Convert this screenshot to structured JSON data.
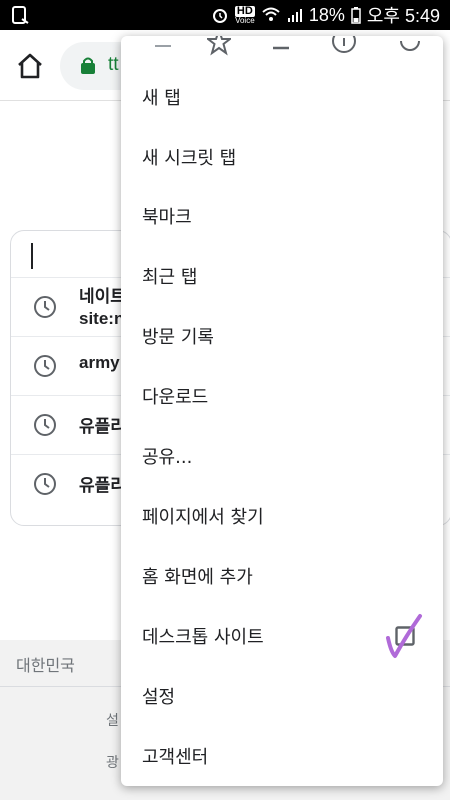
{
  "status_bar": {
    "hd_label": "HD",
    "voice_label": "Voice",
    "battery": "18%",
    "time": "오후 5:49"
  },
  "toolbar": {
    "url_fragment": "tt"
  },
  "suggestions": [
    {
      "line1": "네이트",
      "line2": "site:n"
    },
    {
      "line1": "army"
    },
    {
      "line1": "유플리"
    },
    {
      "line1": "유플리"
    }
  ],
  "footer": {
    "country": "대한민국",
    "line1": "설",
    "line2": "광"
  },
  "menu": {
    "items": [
      {
        "label": "새 탭"
      },
      {
        "label": "새 시크릿 탭"
      },
      {
        "label": "북마크"
      },
      {
        "label": "최근 탭"
      },
      {
        "label": "방문 기록"
      },
      {
        "label": "다운로드"
      },
      {
        "label": "공유..."
      },
      {
        "label": "페이지에서 찾기"
      },
      {
        "label": "홈 화면에 추가"
      },
      {
        "label": "데스크톱 사이트",
        "checkbox": false
      },
      {
        "label": "설정"
      },
      {
        "label": "고객센터"
      }
    ]
  },
  "colors": {
    "accent_green": "#188038",
    "annotation_purple": "#b06ad8"
  }
}
